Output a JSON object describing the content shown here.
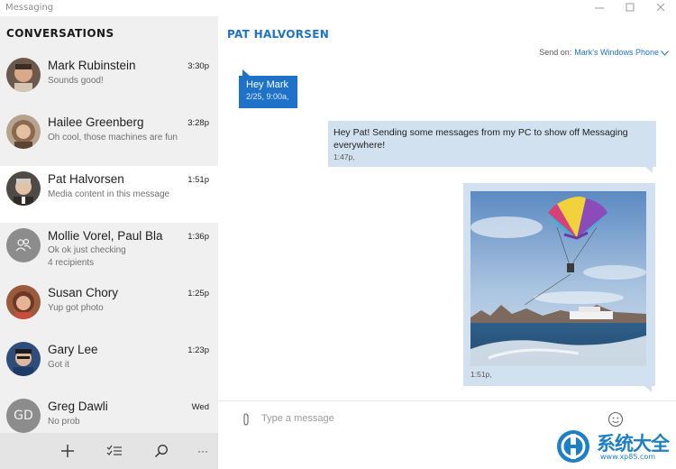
{
  "window": {
    "title": "Messaging",
    "controls": [
      "minimize-icon",
      "maximize-icon",
      "close-icon"
    ]
  },
  "sidebar": {
    "header": "CONVERSATIONS",
    "conversations": [
      {
        "name": "Mark Rubinstein",
        "time": "3:30p",
        "preview": "Sounds good!",
        "avatar": "photo"
      },
      {
        "name": "Hailee Greenberg",
        "time": "3:28p",
        "preview": "Oh cool, those machines are fun",
        "avatar": "photo"
      },
      {
        "name": "Pat Halvorsen",
        "time": "1:51p",
        "preview": "Media content in this message",
        "avatar": "photo",
        "selected": true
      },
      {
        "name": "Mollie Vorel, Paul Bla",
        "time": "1:36p",
        "preview": "Ok ok just checking",
        "sub": "4 recipients",
        "avatar": "group-icon"
      },
      {
        "name": "Susan Chory",
        "time": "1:25p",
        "preview": "Yup got photo",
        "avatar": "photo"
      },
      {
        "name": "Gary Lee",
        "time": "1:23p",
        "preview": "Got it",
        "avatar": "photo"
      },
      {
        "name": "Greg Dawli",
        "time": "Wed",
        "preview": "No prob",
        "avatar": "initials",
        "initials": "GD"
      }
    ],
    "bottom_bar": [
      "add-icon",
      "select-icon",
      "search-icon",
      "more-icon"
    ],
    "more_label": "···"
  },
  "main": {
    "contact_title": "PAT HALVORSEN",
    "send_on": {
      "label": "Send on:",
      "device": "Mark's Windows Phone"
    },
    "messages": [
      {
        "direction": "incoming",
        "text": "Hey Mark",
        "time": "2/25, 9:00a,"
      },
      {
        "direction": "outgoing",
        "text": "Hey Pat! Sending some messages from my PC to show off Messaging everywhere!",
        "time": "1:47p,"
      },
      {
        "direction": "outgoing",
        "type": "photo",
        "time": "1:51p,"
      }
    ],
    "composer": {
      "placeholder": "Type a message"
    }
  },
  "watermark": {
    "text": "系统大全",
    "sub": "www.xp85.com"
  },
  "colors": {
    "accent": "#1e73c8",
    "sidebar_bg": "#f0f0f0",
    "outgoing_bubble": "#d2e1f0"
  }
}
